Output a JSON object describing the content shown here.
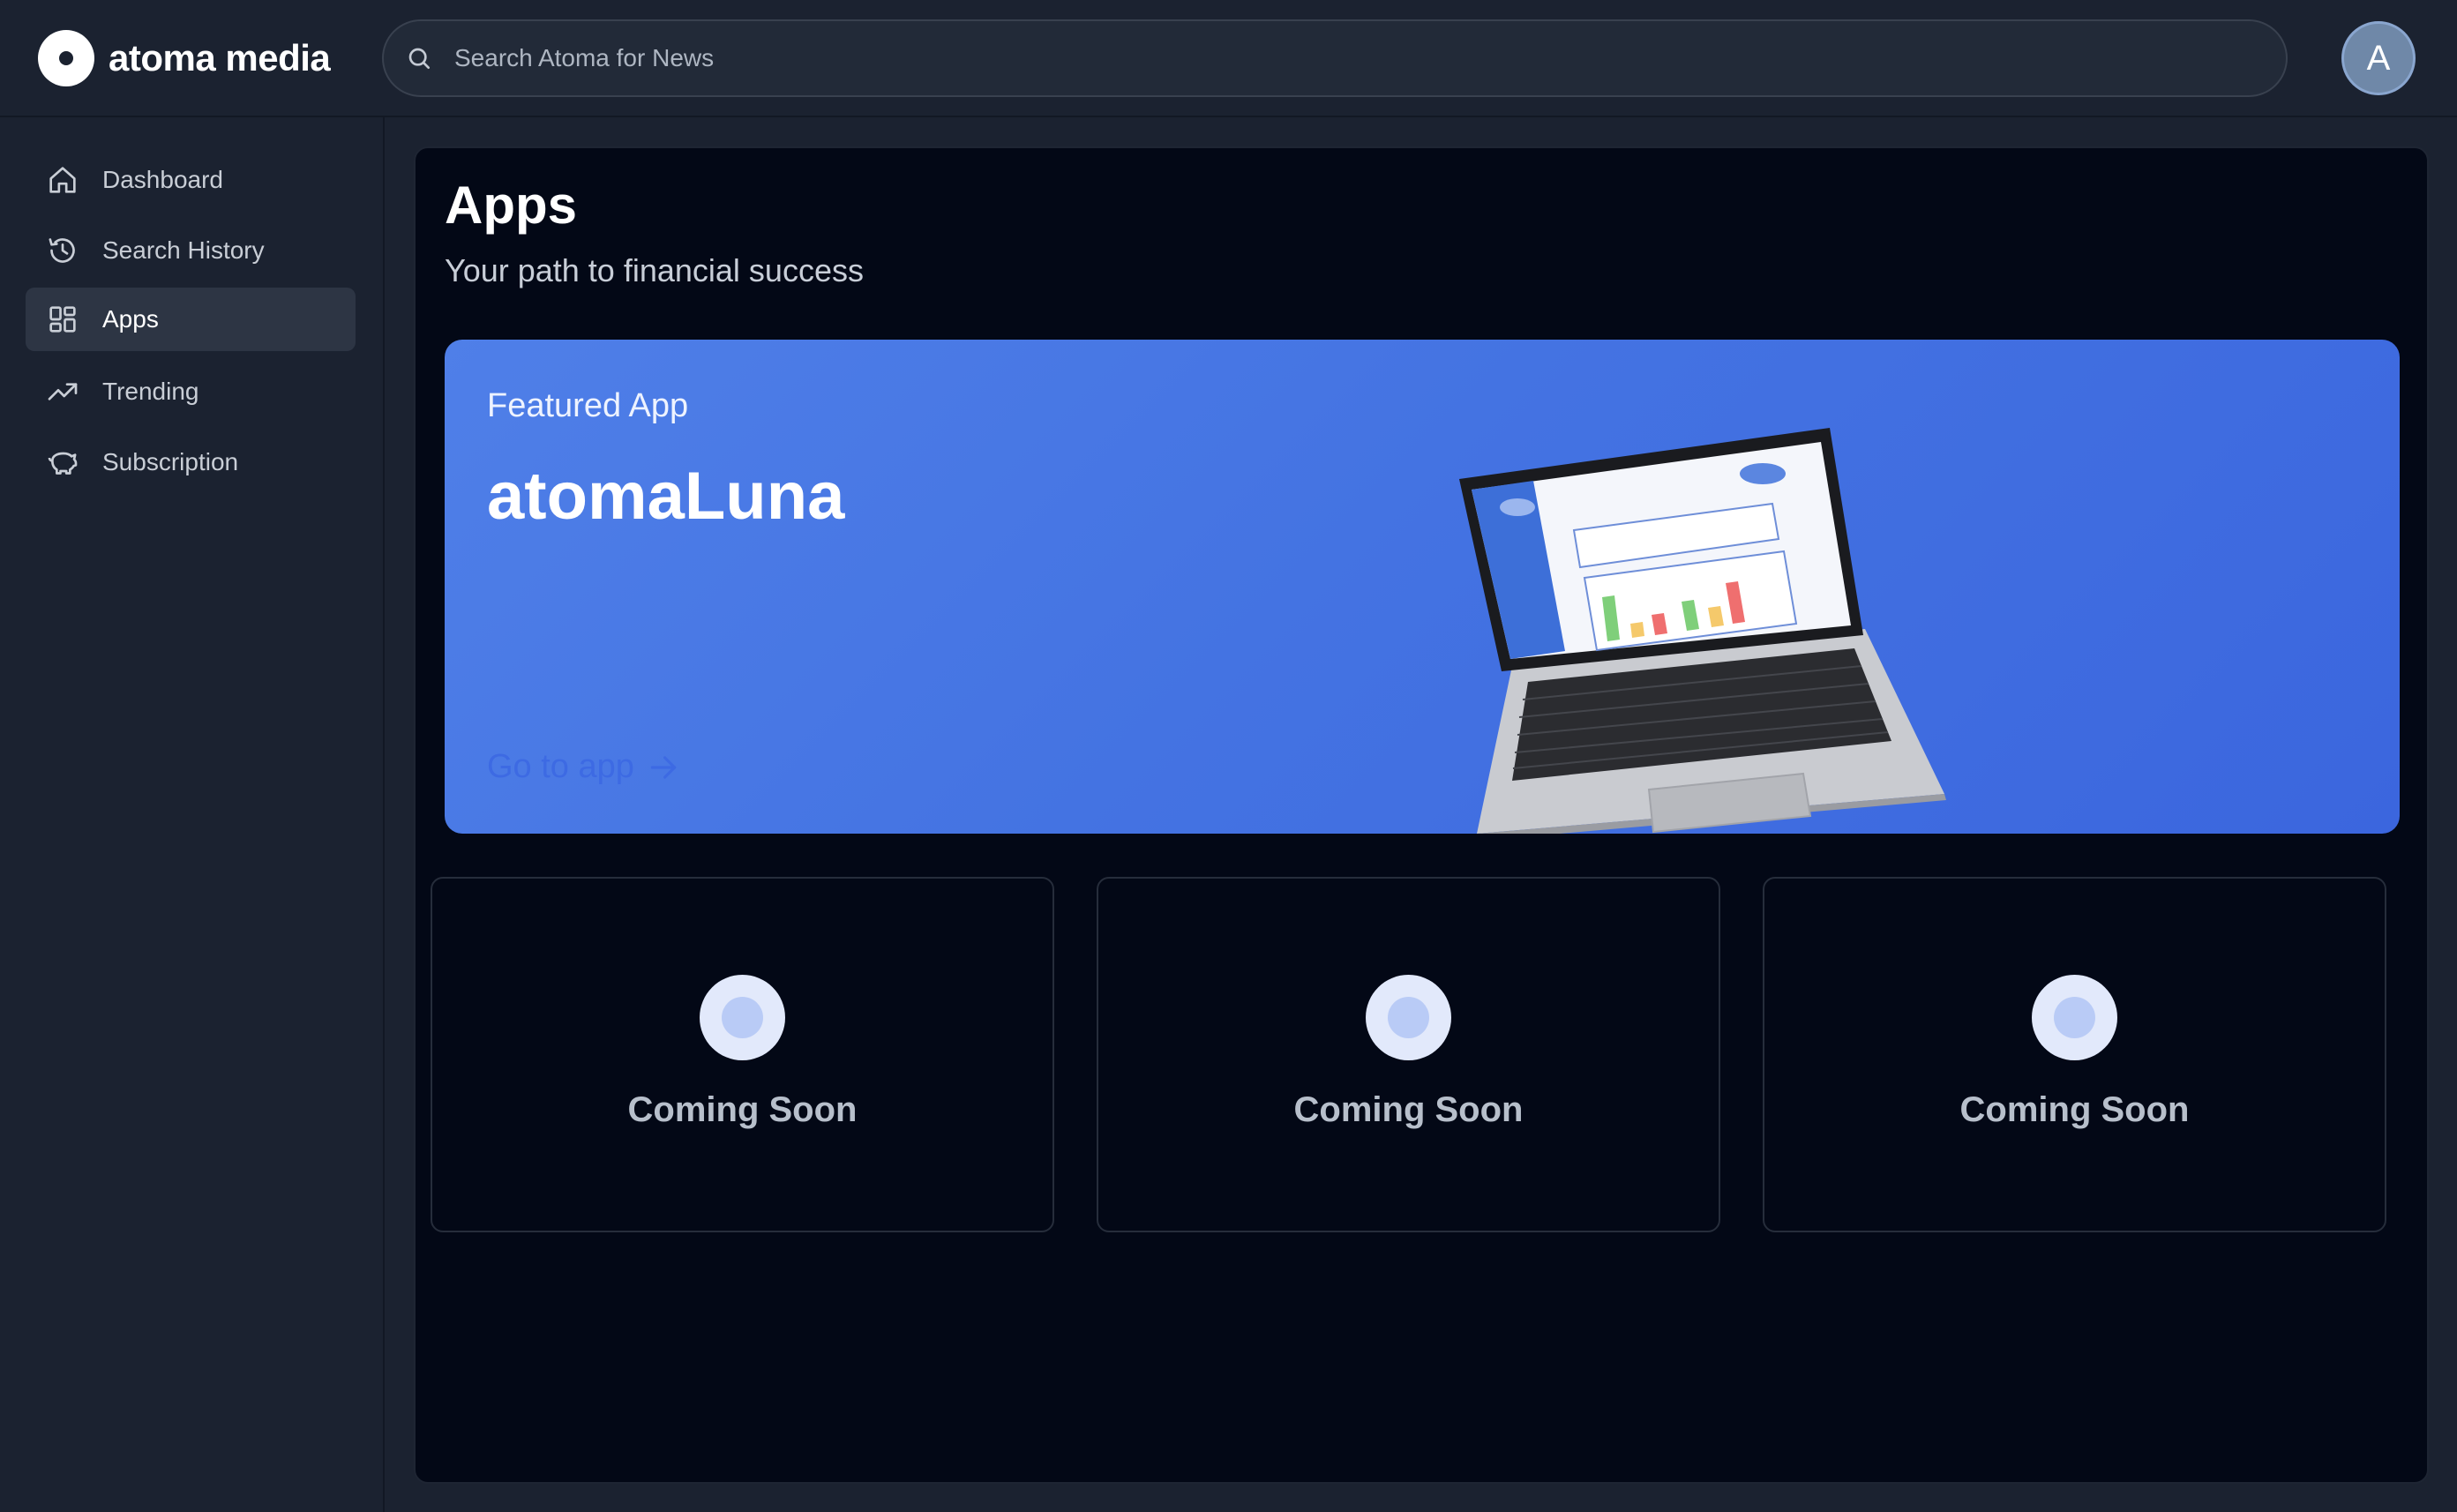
{
  "header": {
    "logo_text": "atoma media",
    "search_placeholder": "Search Atoma for News",
    "avatar_initial": "A"
  },
  "sidebar": {
    "items": [
      {
        "label": "Dashboard",
        "icon": "home-icon",
        "active": false
      },
      {
        "label": "Search History",
        "icon": "history-icon",
        "active": false
      },
      {
        "label": "Apps",
        "icon": "grid-icon",
        "active": true
      },
      {
        "label": "Trending",
        "icon": "trending-icon",
        "active": false
      },
      {
        "label": "Subscription",
        "icon": "piggy-bank-icon",
        "active": false
      }
    ]
  },
  "main": {
    "title": "Apps",
    "subtitle": "Your path to financial success",
    "featured": {
      "kicker": "Featured App",
      "name": "atomaLuna",
      "cta_label": "Go to app",
      "colors": {
        "start": "#4f7fe8",
        "end": "#3b66de"
      }
    },
    "cards": [
      {
        "label": "Coming Soon"
      },
      {
        "label": "Coming Soon"
      },
      {
        "label": "Coming Soon"
      }
    ]
  },
  "colors": {
    "app_background": "#1b2230",
    "panel_background": "#030816",
    "accent": "#4473e2"
  }
}
